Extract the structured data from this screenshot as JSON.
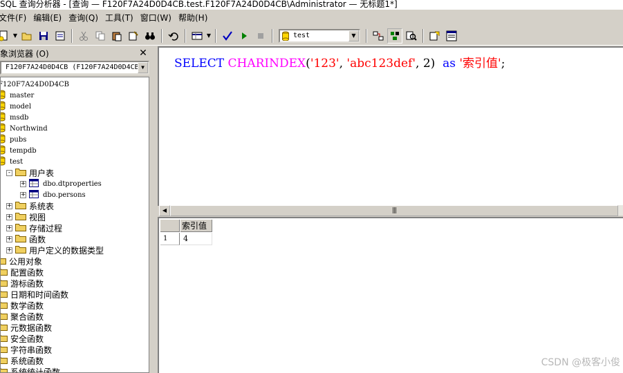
{
  "window": {
    "title": "SQL 查询分析器 - [查询 — F120F7A24D0D4CB.test.F120F7A24D0D4CB\\Administrator — 无标题1*]"
  },
  "menu": {
    "items": [
      {
        "label": "文件(F)"
      },
      {
        "label": "编辑(E)"
      },
      {
        "label": "查询(Q)"
      },
      {
        "label": "工具(T)"
      },
      {
        "label": "窗口(W)"
      },
      {
        "label": "帮助(H)"
      }
    ]
  },
  "toolbar": {
    "database": "test"
  },
  "object_browser": {
    "title": "象浏览器 (O)",
    "server_combo": "F120F7A24D0D4CB (F120F7A24D0D4CB\\",
    "root": "F120F7A24D0D4CB",
    "databases": [
      "master",
      "model",
      "msdb",
      "Northwind",
      "pubs",
      "tempdb",
      "test"
    ],
    "user_tables_folder": "用户表",
    "tables": [
      "dbo.dtproperties",
      "dbo.persons"
    ],
    "other_folders": [
      "系统表",
      "视图",
      "存储过程",
      "函数",
      "用户定义的数据类型"
    ],
    "common_objects": "公用对象",
    "common_folders": [
      "配置函数",
      "游标函数",
      "日期和时间函数",
      "数学函数",
      "聚合函数",
      "元数据函数",
      "安全函数",
      "字符串函数",
      "系统函数",
      "系统统计函数"
    ]
  },
  "editor": {
    "kw_select": "SELECT",
    "fn_charindex": "CHARINDEX",
    "paren_open": "(",
    "str_1": "'123'",
    "comma_1": ",",
    "str_2": "'abc123def'",
    "comma_2": ",",
    "num": "2)",
    "kw_as": "as",
    "alias": "'索引值'",
    "semicolon": ";"
  },
  "results": {
    "column": "索引值",
    "row_number": "1",
    "value": "4"
  },
  "watermark": "CSDN @极客小俊"
}
